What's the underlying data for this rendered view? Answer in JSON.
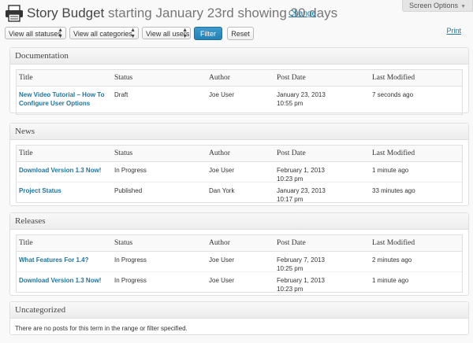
{
  "header": {
    "title": "Story Budget",
    "range_text": "starting January 23rd showing 30 days",
    "change_label": "Change",
    "screen_options_label": "Screen Options",
    "print_label": "Print"
  },
  "filters": {
    "statuses": "View all statuses",
    "categories": "View all categories",
    "users": "View all users",
    "filter_button": "Filter",
    "reset_button": "Reset"
  },
  "columns": {
    "title": "Title",
    "status": "Status",
    "author": "Author",
    "post_date": "Post Date",
    "last_modified": "Last Modified"
  },
  "sections": [
    {
      "name": "Documentation",
      "rows": [
        {
          "title_line1": "New Video Tutorial – How To",
          "title_line2": "Configure User Options",
          "status": "Draft",
          "author": "Joe User",
          "date_line1": "January 23, 2013",
          "date_line2": "10:55 pm",
          "last_modified": "7 seconds ago"
        }
      ]
    },
    {
      "name": "News",
      "rows": [
        {
          "title_line1": "Download Version 1.3 Now!",
          "status": "In Progress",
          "author": "Joe User",
          "date_line1": "February 1, 2013",
          "date_line2": "10:23 pm",
          "last_modified": "1 minute ago"
        },
        {
          "title_line1": "Project Status",
          "status": "Published",
          "author": "Dan York",
          "date_line1": "January 23, 2013",
          "date_line2": "10:17 pm",
          "last_modified": "33 minutes ago"
        }
      ]
    },
    {
      "name": "Releases",
      "rows": [
        {
          "title_line1": "What Features For 1.4?",
          "status": "In Progress",
          "author": "Joe User",
          "date_line1": "February 7, 2013",
          "date_line2": "10:25 pm",
          "last_modified": "2 minutes ago"
        },
        {
          "title_line1": "Download Version 1.3 Now!",
          "status": "In Progress",
          "author": "Joe User",
          "date_line1": "February 1, 2013",
          "date_line2": "10:23 pm",
          "last_modified": "1 minute ago"
        }
      ]
    },
    {
      "name": "Uncategorized",
      "empty_message": "There are no posts for this term in the range or filter specified."
    }
  ],
  "colors": {
    "link": "#21759b",
    "filter_button": "#2e8bc0"
  },
  "icons": {
    "page_icon": "printer-icon"
  }
}
